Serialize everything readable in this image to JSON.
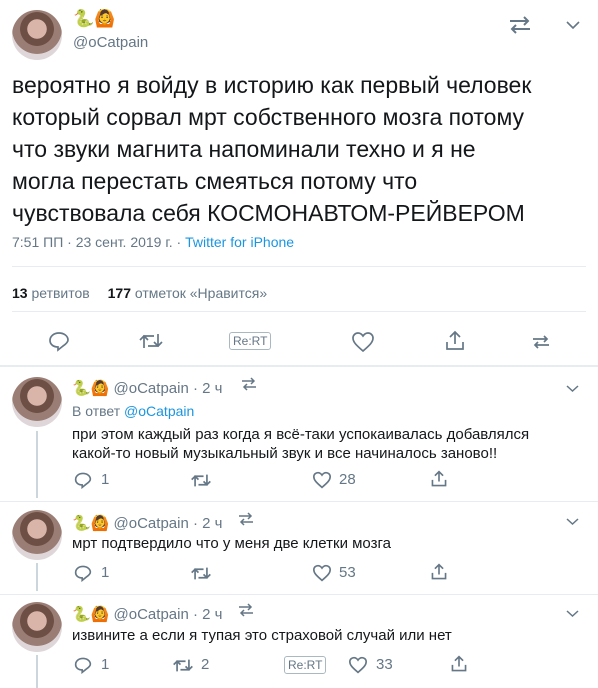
{
  "main_tweet": {
    "emoji": "🐍🙆",
    "handle": "@oCatpain",
    "text_lines": [
      "вероятно я войду в историю как первый человек",
      "который сорвал мрт собственного мозга потому",
      "что звуки магнита напоминали техно и я не",
      "могла перестать смеяться потому что",
      "чувствовала себя КОСМОНАВТОМ-РЕЙВЕРОМ"
    ],
    "timestamp": "7:51 ПП · 23 сент. 2019 г.",
    "source": "Twitter for iPhone",
    "retweets_count": "13",
    "retweets_label": "ретвитов",
    "likes_count": "177",
    "likes_label": "отметок «Нравится»",
    "rert_label": "Re:RT"
  },
  "replies": [
    {
      "emoji": "🐍🙆",
      "handle": "@oCatpain",
      "time": "· 2 ч",
      "reply_to_prefix": "В ответ",
      "reply_to_handle": "@oCatpain",
      "text_lines": [
        "при этом каждый раз когда я всё-таки успокаивалась добавлялся",
        "какой-то новый музыкальный звук и все начиналось заново!!"
      ],
      "replies": "1",
      "retweets": "",
      "likes": "28"
    },
    {
      "emoji": "🐍🙆",
      "handle": "@oCatpain",
      "time": "· 2 ч",
      "text_lines": [
        "мрт подтвердило что у меня две клетки мозга"
      ],
      "replies": "1",
      "retweets": "",
      "likes": "53"
    },
    {
      "emoji": "🐍🙆",
      "handle": "@oCatpain",
      "time": "· 2 ч",
      "text_lines": [
        "извините а если я тупая это страховой случай или нет"
      ],
      "replies": "1",
      "retweets": "2",
      "rert_label": "Re:RT",
      "likes": "33"
    }
  ],
  "colors": {
    "link": "#1b95e0",
    "muted": "#657786",
    "divider": "#e6ecf0"
  }
}
